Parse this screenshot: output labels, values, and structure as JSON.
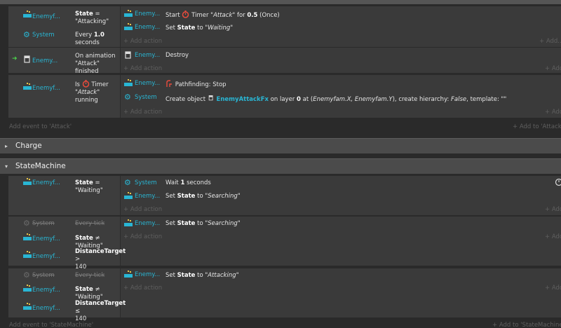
{
  "colors": {
    "accent": "#29b6d4",
    "timer_red": "#e84b3c",
    "background": "#2a2a2a"
  },
  "attack_group": {
    "events": [
      {
        "conditions": [
          {
            "object": "Enemyf...",
            "icon": "enemy-sprite-icon",
            "text_bold": "State",
            "text_rest": " =",
            "text_line2": "\"Attacking\""
          },
          {
            "object": "System",
            "icon": "gear-icon",
            "text_plain": "Every ",
            "text_bold": "1.0",
            "text_rest": " seconds"
          }
        ],
        "actions": [
          {
            "object": "Enemy...",
            "pre": "Start ",
            "timer_label": " Timer ",
            "name": "\"Attack\"",
            "mid": " for ",
            "value": "0.5",
            "post": " (Once)"
          },
          {
            "object": "Enemy...",
            "pre": "Set ",
            "bold": "State",
            "mid": " to ",
            "value": "\"Waiting\""
          }
        ],
        "add_action": "+ Add action",
        "add_action_right": "+ Add..."
      },
      {
        "conditions": [
          {
            "object": "Enemy...",
            "icon": "sprite-icon",
            "text_line1": "On animation",
            "text_line2": "\"Attack\" finished"
          }
        ],
        "actions": [
          {
            "object": "Enemy...",
            "text": "Destroy"
          }
        ],
        "add_action": "+ Add action",
        "add_action_right": "+ Add..."
      },
      {
        "conditions": [
          {
            "object": "Enemyf...",
            "icon": "enemy-sprite-icon",
            "pre": "Is ",
            "timer_label": " Timer",
            "name": "\"Attack\"",
            "post": " running"
          }
        ],
        "actions": [
          {
            "object": "Enemy...",
            "text": "Pathfinding: Stop"
          },
          {
            "object": "System",
            "pre": "Create object ",
            "target": "EnemyAttackFx",
            "mid": " on layer ",
            "layer": "0",
            "at": " at (",
            "coords": "Enemyfam.X, Enemyfam.Y",
            "hier": "), create hierarchy: ",
            "hier_val": "False",
            "tpl": ", template: \"\""
          }
        ],
        "add_action": "+ Add action",
        "add_action_right": "+ Add..."
      }
    ],
    "add_event": "Add event to 'Attack'",
    "add_event_right": "+ Add to 'Attack..."
  },
  "groups": [
    {
      "title": "Charge",
      "arrow": "▸"
    },
    {
      "title": "StateMachine",
      "arrow": "▾"
    }
  ],
  "statemachine": {
    "events": [
      {
        "conditions": [
          {
            "object": "Enemyf...",
            "bold": "State",
            "rest": " = \"Waiting\""
          }
        ],
        "actions": [
          {
            "object": "System",
            "pre": "Wait ",
            "bold": "1",
            "post": " seconds"
          },
          {
            "object": "Enemy...",
            "pre": "Set ",
            "bold": "State",
            "mid": " to ",
            "value": "\"Searching\""
          }
        ],
        "add_action": "+ Add action",
        "add_action_right": "+ Add..."
      },
      {
        "conditions": [
          {
            "object": "System",
            "text": "Every tick",
            "disabled": true
          },
          {
            "object": "Enemyf...",
            "bold": "State",
            "rest": " ≠ \"Waiting\""
          },
          {
            "object": "Enemyf...",
            "bold": "DistanceTarget",
            "rest": " >",
            "line2": "140"
          }
        ],
        "actions": [
          {
            "object": "Enemy...",
            "pre": "Set ",
            "bold": "State",
            "mid": " to ",
            "value": "\"Searching\""
          }
        ],
        "add_action": "+ Add action",
        "add_action_right": "+ Add..."
      },
      {
        "conditions": [
          {
            "object": "System",
            "text": "Every tick",
            "disabled": true
          },
          {
            "object": "Enemyf...",
            "bold": "State",
            "rest": " ≠ \"Waiting\""
          },
          {
            "object": "Enemyf...",
            "bold": "DistanceTarget",
            "rest": " ≤",
            "line2": "140"
          }
        ],
        "actions": [
          {
            "object": "Enemy...",
            "pre": "Set ",
            "bold": "State",
            "mid": " to ",
            "value": "\"Attacking\""
          }
        ],
        "add_action": "+ Add action",
        "add_action_right": "+ Add..."
      }
    ],
    "add_event": "Add event to 'StateMachine'",
    "add_event_right": "+ Add to 'StateMachine..."
  }
}
